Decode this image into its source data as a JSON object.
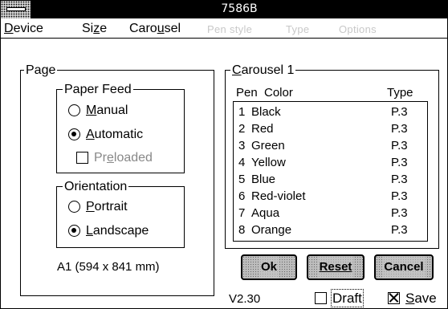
{
  "window": {
    "title": "7586B"
  },
  "menu": {
    "device": {
      "pre": "",
      "key": "D",
      "post": "evice"
    },
    "size": {
      "pre": "Si",
      "key": "z",
      "post": "e"
    },
    "carousel": {
      "pre": "Caro",
      "key": "u",
      "post": "sel"
    },
    "disabled_items": [
      "Pen style",
      "Type",
      "Options"
    ]
  },
  "page_group": {
    "legend": "Page",
    "paper_feed": {
      "legend": "Paper Feed",
      "manual": {
        "key": "M",
        "rest": "anual",
        "selected": false
      },
      "automatic": {
        "key": "A",
        "rest": "utomatic",
        "selected": true
      },
      "preloaded": {
        "pre": "Pr",
        "key": "e",
        "post": "loaded",
        "checked": false,
        "enabled": false
      }
    },
    "orientation": {
      "legend": "Orientation",
      "portrait": {
        "key": "P",
        "rest": "ortrait",
        "selected": false
      },
      "landscape": {
        "key": "L",
        "rest": "andscape",
        "selected": true
      }
    },
    "paper_size": "A1 (594 x 841 mm)"
  },
  "carousel_group": {
    "legend_key": "C",
    "legend_rest": "arousel 1",
    "headers": {
      "pen": "Pen",
      "color": "Color",
      "type": "Type"
    },
    "pens": [
      {
        "num": "1",
        "color": "Black",
        "type": "P.3"
      },
      {
        "num": "2",
        "color": "Red",
        "type": "P.3"
      },
      {
        "num": "3",
        "color": "Green",
        "type": "P.3"
      },
      {
        "num": "4",
        "color": "Yellow",
        "type": "P.3"
      },
      {
        "num": "5",
        "color": "Blue",
        "type": "P.3"
      },
      {
        "num": "6",
        "color": "Red-violet",
        "type": "P.3"
      },
      {
        "num": "7",
        "color": "Aqua",
        "type": "P.3"
      },
      {
        "num": "8",
        "color": "Orange",
        "type": "P.3"
      }
    ]
  },
  "buttons": {
    "ok": "Ok",
    "reset": "Reset",
    "cancel": "Cancel"
  },
  "footer": {
    "version": "V2.30",
    "draft": {
      "label": "Draft",
      "checked": false
    },
    "save": {
      "key": "S",
      "rest": "ave",
      "checked": true
    }
  },
  "icons": {
    "system_menu": "system-menu-icon"
  }
}
